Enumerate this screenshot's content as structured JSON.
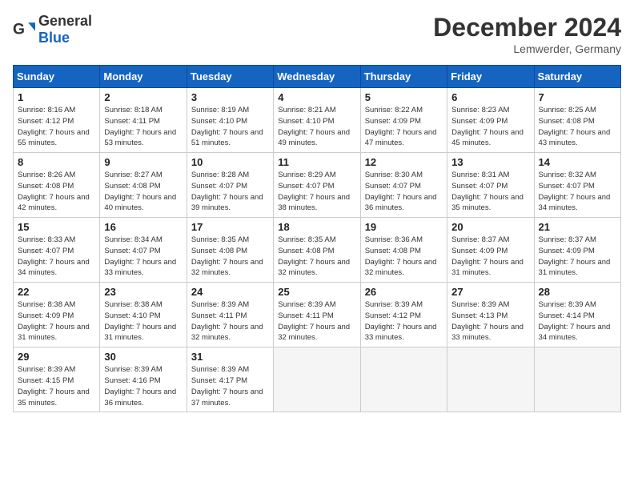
{
  "logo": {
    "general": "General",
    "blue": "Blue"
  },
  "title": "December 2024",
  "subtitle": "Lemwerder, Germany",
  "days_header": [
    "Sunday",
    "Monday",
    "Tuesday",
    "Wednesday",
    "Thursday",
    "Friday",
    "Saturday"
  ],
  "weeks": [
    [
      {
        "day": "1",
        "sunrise": "8:16 AM",
        "sunset": "4:12 PM",
        "daylight": "7 hours and 55 minutes."
      },
      {
        "day": "2",
        "sunrise": "8:18 AM",
        "sunset": "4:11 PM",
        "daylight": "7 hours and 53 minutes."
      },
      {
        "day": "3",
        "sunrise": "8:19 AM",
        "sunset": "4:10 PM",
        "daylight": "7 hours and 51 minutes."
      },
      {
        "day": "4",
        "sunrise": "8:21 AM",
        "sunset": "4:10 PM",
        "daylight": "7 hours and 49 minutes."
      },
      {
        "day": "5",
        "sunrise": "8:22 AM",
        "sunset": "4:09 PM",
        "daylight": "7 hours and 47 minutes."
      },
      {
        "day": "6",
        "sunrise": "8:23 AM",
        "sunset": "4:09 PM",
        "daylight": "7 hours and 45 minutes."
      },
      {
        "day": "7",
        "sunrise": "8:25 AM",
        "sunset": "4:08 PM",
        "daylight": "7 hours and 43 minutes."
      }
    ],
    [
      {
        "day": "8",
        "sunrise": "8:26 AM",
        "sunset": "4:08 PM",
        "daylight": "7 hours and 42 minutes."
      },
      {
        "day": "9",
        "sunrise": "8:27 AM",
        "sunset": "4:08 PM",
        "daylight": "7 hours and 40 minutes."
      },
      {
        "day": "10",
        "sunrise": "8:28 AM",
        "sunset": "4:07 PM",
        "daylight": "7 hours and 39 minutes."
      },
      {
        "day": "11",
        "sunrise": "8:29 AM",
        "sunset": "4:07 PM",
        "daylight": "7 hours and 38 minutes."
      },
      {
        "day": "12",
        "sunrise": "8:30 AM",
        "sunset": "4:07 PM",
        "daylight": "7 hours and 36 minutes."
      },
      {
        "day": "13",
        "sunrise": "8:31 AM",
        "sunset": "4:07 PM",
        "daylight": "7 hours and 35 minutes."
      },
      {
        "day": "14",
        "sunrise": "8:32 AM",
        "sunset": "4:07 PM",
        "daylight": "7 hours and 34 minutes."
      }
    ],
    [
      {
        "day": "15",
        "sunrise": "8:33 AM",
        "sunset": "4:07 PM",
        "daylight": "7 hours and 34 minutes."
      },
      {
        "day": "16",
        "sunrise": "8:34 AM",
        "sunset": "4:07 PM",
        "daylight": "7 hours and 33 minutes."
      },
      {
        "day": "17",
        "sunrise": "8:35 AM",
        "sunset": "4:08 PM",
        "daylight": "7 hours and 32 minutes."
      },
      {
        "day": "18",
        "sunrise": "8:35 AM",
        "sunset": "4:08 PM",
        "daylight": "7 hours and 32 minutes."
      },
      {
        "day": "19",
        "sunrise": "8:36 AM",
        "sunset": "4:08 PM",
        "daylight": "7 hours and 32 minutes."
      },
      {
        "day": "20",
        "sunrise": "8:37 AM",
        "sunset": "4:09 PM",
        "daylight": "7 hours and 31 minutes."
      },
      {
        "day": "21",
        "sunrise": "8:37 AM",
        "sunset": "4:09 PM",
        "daylight": "7 hours and 31 minutes."
      }
    ],
    [
      {
        "day": "22",
        "sunrise": "8:38 AM",
        "sunset": "4:09 PM",
        "daylight": "7 hours and 31 minutes."
      },
      {
        "day": "23",
        "sunrise": "8:38 AM",
        "sunset": "4:10 PM",
        "daylight": "7 hours and 31 minutes."
      },
      {
        "day": "24",
        "sunrise": "8:39 AM",
        "sunset": "4:11 PM",
        "daylight": "7 hours and 32 minutes."
      },
      {
        "day": "25",
        "sunrise": "8:39 AM",
        "sunset": "4:11 PM",
        "daylight": "7 hours and 32 minutes."
      },
      {
        "day": "26",
        "sunrise": "8:39 AM",
        "sunset": "4:12 PM",
        "daylight": "7 hours and 33 minutes."
      },
      {
        "day": "27",
        "sunrise": "8:39 AM",
        "sunset": "4:13 PM",
        "daylight": "7 hours and 33 minutes."
      },
      {
        "day": "28",
        "sunrise": "8:39 AM",
        "sunset": "4:14 PM",
        "daylight": "7 hours and 34 minutes."
      }
    ],
    [
      {
        "day": "29",
        "sunrise": "8:39 AM",
        "sunset": "4:15 PM",
        "daylight": "7 hours and 35 minutes."
      },
      {
        "day": "30",
        "sunrise": "8:39 AM",
        "sunset": "4:16 PM",
        "daylight": "7 hours and 36 minutes."
      },
      {
        "day": "31",
        "sunrise": "8:39 AM",
        "sunset": "4:17 PM",
        "daylight": "7 hours and 37 minutes."
      },
      null,
      null,
      null,
      null
    ]
  ]
}
